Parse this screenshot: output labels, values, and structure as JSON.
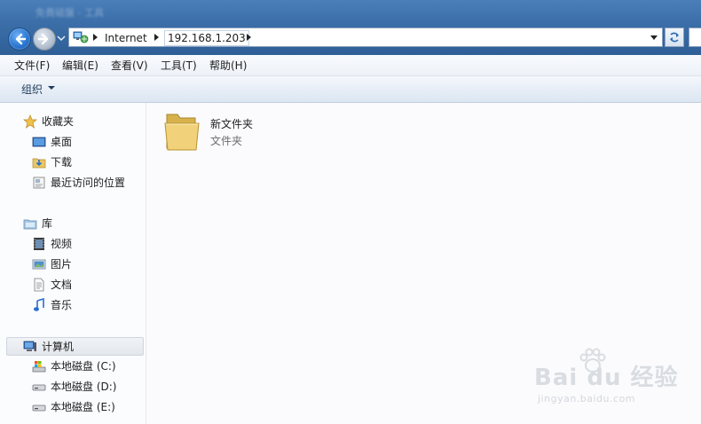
{
  "window": {
    "title_blurred": "免費磁盤 - 工具"
  },
  "address_bar": {
    "crumbs": [
      "Internet",
      "192.168.1.203"
    ]
  },
  "menu": {
    "items": [
      "文件(F)",
      "编辑(E)",
      "查看(V)",
      "工具(T)",
      "帮助(H)"
    ]
  },
  "command_bar": {
    "organize_label": "组织"
  },
  "nav_pane": {
    "favorites": {
      "label": "收藏夹",
      "items": [
        "桌面",
        "下载",
        "最近访问的位置"
      ]
    },
    "libraries": {
      "label": "库",
      "items": [
        "视频",
        "图片",
        "文档",
        "音乐"
      ]
    },
    "computer": {
      "label": "计算机",
      "items": [
        "本地磁盘 (C:)",
        "本地磁盘 (D:)",
        "本地磁盘 (E:)"
      ]
    }
  },
  "content": {
    "items": [
      {
        "name": "新文件夹",
        "type": "文件夹"
      }
    ]
  },
  "watermark": {
    "brand": "Bai du 经验",
    "url": "jingyan.baidu.com"
  },
  "colors": {
    "accent": "#2f5f97",
    "selection": "#e3e7ec"
  }
}
